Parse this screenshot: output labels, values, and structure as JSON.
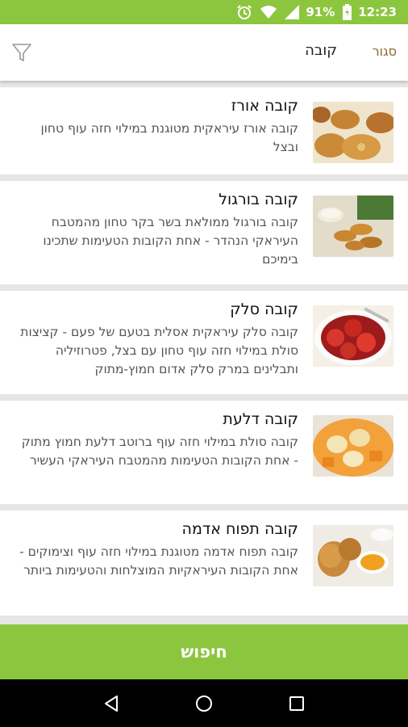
{
  "status": {
    "battery": "91%",
    "time": "12:23"
  },
  "header": {
    "title": "קובה",
    "close_label": "סגור"
  },
  "items": [
    {
      "name": "קובה אורז",
      "description": "קובה אורז עיראקית מטוגנת במילוי חזה עוף טחון ובצל",
      "image": "fried-kubbeh-photo"
    },
    {
      "name": "קובה בורגול",
      "description": "קובה בורגול ממולאת בשר בקר טחון מהמטבח העיראקי הנהדר - אחת הקובות הטעימות שתכינו בימיכם",
      "image": "kubbeh-burgul-photo"
    },
    {
      "name": "קובה סלק",
      "description": "קובה סלק עיראקית אסלית בטעם של פעם - קציצות סולת במילוי חזה עוף טחון עם בצל, פטרוזיליה ותבלינים במרק סלק אדום חמוץ-מתוק",
      "image": "beet-kubbeh-soup-photo"
    },
    {
      "name": "קובה דלעת",
      "description": "קובה סולת במילוי חזה עוף ברוטב דלעת חמוץ מתוק - אחת הקובות הטעימות מהמטבח העיראקי העשיר",
      "image": "pumpkin-kubbeh-photo"
    },
    {
      "name": "קובה תפוח אדמה",
      "description": "קובה תפוח אדמה מטוגנת במילוי חזה עוף וצימוקים - אחת הקובות העיראקיות המוצלחות והטעימות ביותר",
      "image": "potato-kubbeh-photo"
    }
  ],
  "search_button": {
    "label": "חיפוש"
  },
  "colors": {
    "accent": "#8cc63f",
    "close_text": "#8b6a2e"
  }
}
